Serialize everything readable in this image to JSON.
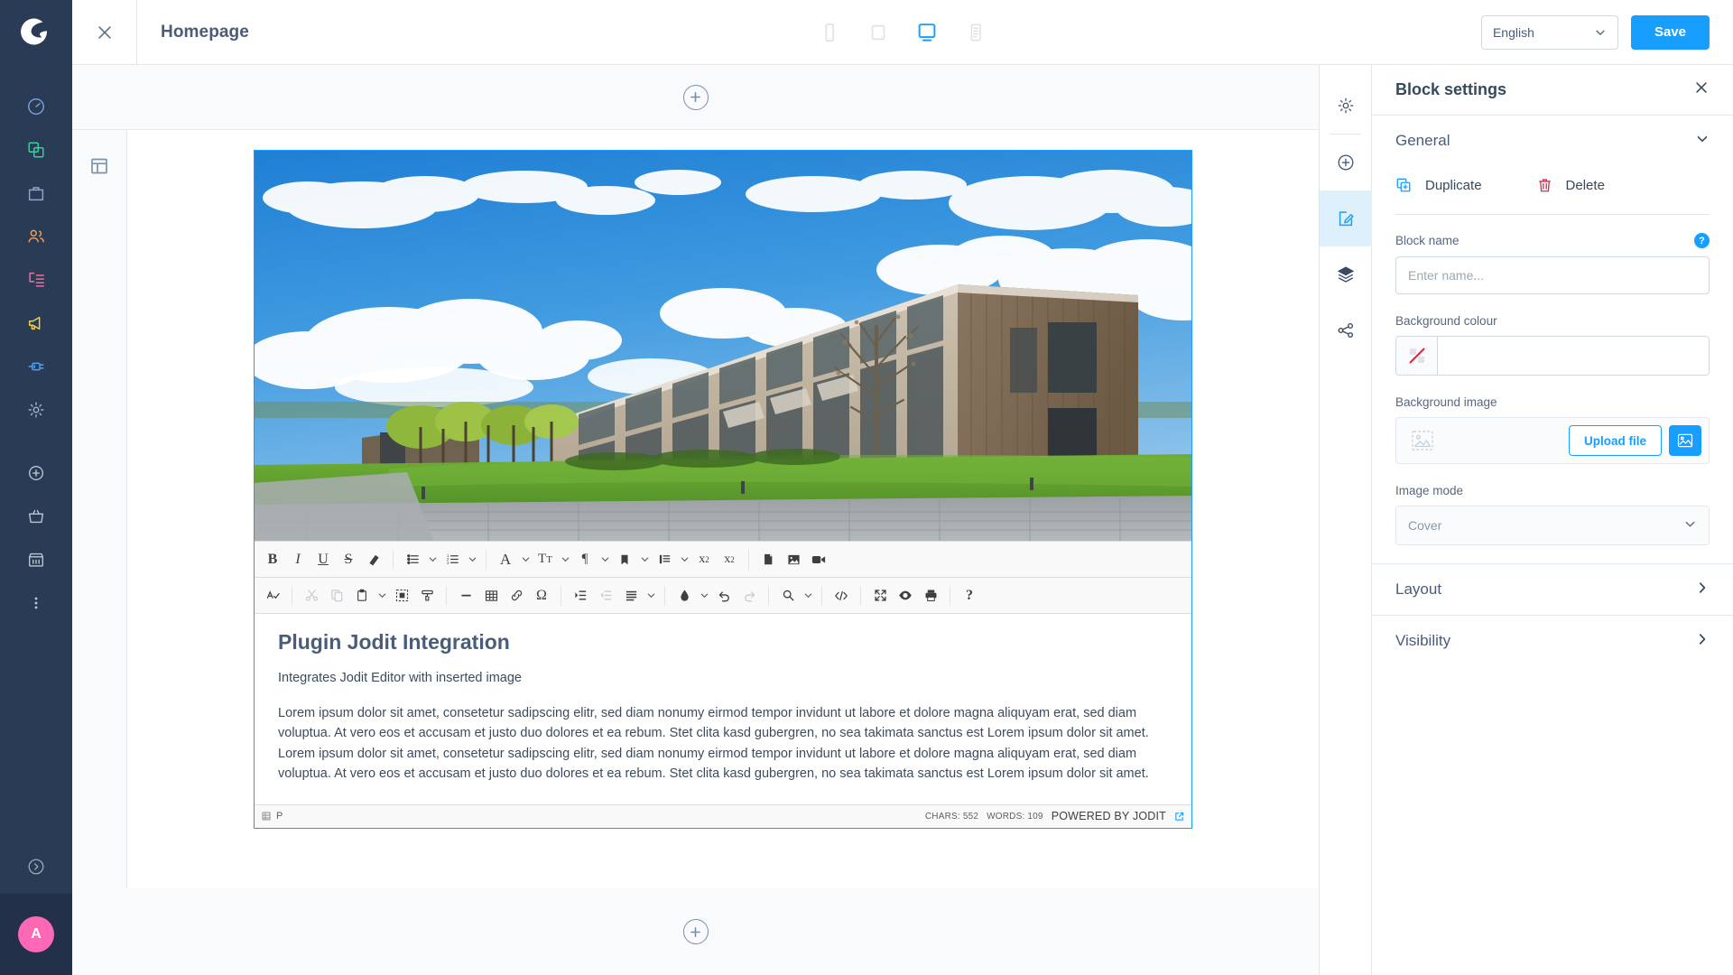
{
  "app": {
    "logo_name": "shopware-logo",
    "avatar_initial": "A",
    "accent_blue": "#189eff",
    "rail_bg": "#2a3b55",
    "avatar_bg": "#ff68b4"
  },
  "nav": {
    "items": [
      {
        "name": "dashboard-icon",
        "label": "Dashboard",
        "color": "#7a9fd4"
      },
      {
        "name": "catalogues-icon",
        "label": "Catalogues",
        "color": "#37d1a0"
      },
      {
        "name": "orders-icon",
        "label": "Orders",
        "color": "#8fa7c4"
      },
      {
        "name": "customers-icon",
        "label": "Customers",
        "color": "#f59b4e"
      },
      {
        "name": "content-icon",
        "label": "Content",
        "color": "#f26da0"
      },
      {
        "name": "marketing-icon",
        "label": "Marketing",
        "color": "#f2d43c"
      },
      {
        "name": "extensions-icon",
        "label": "Extensions",
        "color": "#4da2f5"
      },
      {
        "name": "settings-icon",
        "label": "Settings",
        "color": "#9fb0c6"
      }
    ],
    "secondary": [
      {
        "name": "add-icon",
        "label": "Add"
      },
      {
        "name": "basket-icon",
        "label": "Basket"
      },
      {
        "name": "storefront-icon",
        "label": "Storefront"
      },
      {
        "name": "more-options-icon",
        "label": "More"
      }
    ],
    "expand": {
      "name": "expand-sidebar-icon",
      "label": "Expand"
    }
  },
  "header": {
    "close_label": "Close",
    "title": "Homepage",
    "devices": [
      {
        "name": "device-mobile-icon",
        "label": "Mobile",
        "active": false
      },
      {
        "name": "device-tablet-icon",
        "label": "Tablet",
        "active": false
      },
      {
        "name": "device-desktop-icon",
        "label": "Desktop",
        "active": true
      },
      {
        "name": "device-form-icon",
        "label": "Form",
        "active": false
      }
    ],
    "language": "English",
    "save_label": "Save"
  },
  "stage": {
    "add_block_top_label": "Add block",
    "add_block_bottom_label": "Add block",
    "sidebar_toggle_name": "layout-panel-icon",
    "hero_image_alt": "Modern wooden office building with blue sky and green lawn"
  },
  "editor": {
    "toolbar_row1": [
      {
        "name": "bold-button",
        "glyph": "B",
        "style": "bold-serif",
        "disabled": false
      },
      {
        "name": "italic-button",
        "glyph": "I",
        "style": "italic-serif",
        "disabled": false
      },
      {
        "name": "underline-button",
        "glyph": "U",
        "style": "underline-serif",
        "disabled": false
      },
      {
        "name": "strikethrough-button",
        "glyph": "S",
        "style": "strike-serif",
        "disabled": false
      },
      {
        "name": "eraser-button",
        "glyph": "eraser",
        "style": "svg",
        "disabled": false
      },
      {
        "name": "separator",
        "glyph": "",
        "style": "sep",
        "disabled": false
      },
      {
        "name": "unordered-list-button",
        "glyph": "ul",
        "style": "svg",
        "disabled": false
      },
      {
        "name": "unordered-list-caret",
        "glyph": "caret",
        "style": "caret",
        "disabled": false
      },
      {
        "name": "ordered-list-button",
        "glyph": "ol",
        "style": "svg",
        "disabled": false
      },
      {
        "name": "ordered-list-caret",
        "glyph": "caret",
        "style": "caret",
        "disabled": false
      },
      {
        "name": "separator",
        "glyph": "",
        "style": "sep",
        "disabled": false
      },
      {
        "name": "font-family-button",
        "glyph": "A",
        "style": "serif",
        "disabled": false
      },
      {
        "name": "font-family-caret",
        "glyph": "caret",
        "style": "caret",
        "disabled": false
      },
      {
        "name": "font-size-button",
        "glyph": "TT",
        "style": "serif-sm",
        "disabled": false
      },
      {
        "name": "font-size-caret",
        "glyph": "caret",
        "style": "caret",
        "disabled": false
      },
      {
        "name": "paragraph-button",
        "glyph": "¶",
        "style": "serif",
        "disabled": false
      },
      {
        "name": "paragraph-caret",
        "glyph": "caret",
        "style": "caret",
        "disabled": false
      },
      {
        "name": "classes-button",
        "glyph": "book",
        "style": "svg",
        "disabled": false
      },
      {
        "name": "classes-caret",
        "glyph": "caret",
        "style": "caret",
        "disabled": false
      },
      {
        "name": "line-height-button",
        "glyph": "lineheight",
        "style": "svg",
        "disabled": false
      },
      {
        "name": "line-height-caret",
        "glyph": "caret",
        "style": "caret",
        "disabled": false
      },
      {
        "name": "superscript-button",
        "glyph": "x²",
        "style": "sup",
        "disabled": false
      },
      {
        "name": "subscript-button",
        "glyph": "x₂",
        "style": "sub",
        "disabled": false
      },
      {
        "name": "separator",
        "glyph": "",
        "style": "sep",
        "disabled": false
      },
      {
        "name": "insert-file-button",
        "glyph": "file",
        "style": "svg",
        "disabled": false
      },
      {
        "name": "insert-image-button",
        "glyph": "image",
        "style": "svg",
        "disabled": false
      },
      {
        "name": "insert-video-button",
        "glyph": "video",
        "style": "svg",
        "disabled": false
      }
    ],
    "toolbar_row2": [
      {
        "name": "spellcheck-button",
        "glyph": "spell",
        "style": "svg",
        "disabled": false
      },
      {
        "name": "separator",
        "glyph": "",
        "style": "sep",
        "disabled": false
      },
      {
        "name": "cut-button",
        "glyph": "scissors",
        "style": "svg",
        "disabled": true
      },
      {
        "name": "copy-button",
        "glyph": "copy",
        "style": "svg",
        "disabled": true
      },
      {
        "name": "paste-button",
        "glyph": "paste",
        "style": "svg",
        "disabled": false
      },
      {
        "name": "paste-caret",
        "glyph": "caret",
        "style": "caret",
        "disabled": false
      },
      {
        "name": "select-all-button",
        "glyph": "selectall",
        "style": "svg",
        "disabled": false
      },
      {
        "name": "format-brush-button",
        "glyph": "brush",
        "style": "svg",
        "disabled": false
      },
      {
        "name": "separator",
        "glyph": "",
        "style": "sep",
        "disabled": false
      },
      {
        "name": "horizontal-rule-button",
        "glyph": "hr",
        "style": "svg",
        "disabled": false
      },
      {
        "name": "insert-table-button",
        "glyph": "table",
        "style": "svg",
        "disabled": false
      },
      {
        "name": "insert-link-button",
        "glyph": "link",
        "style": "svg",
        "disabled": false
      },
      {
        "name": "special-character-button",
        "glyph": "Ω",
        "style": "serif",
        "disabled": false
      },
      {
        "name": "separator",
        "glyph": "",
        "style": "sep",
        "disabled": false
      },
      {
        "name": "indent-button",
        "glyph": "indent",
        "style": "svg",
        "disabled": false
      },
      {
        "name": "outdent-button",
        "glyph": "outdent",
        "style": "svg",
        "disabled": true
      },
      {
        "name": "align-button",
        "glyph": "align",
        "style": "svg",
        "disabled": false
      },
      {
        "name": "align-caret",
        "glyph": "caret",
        "style": "caret",
        "disabled": false
      },
      {
        "name": "separator",
        "glyph": "",
        "style": "sep",
        "disabled": false
      },
      {
        "name": "text-color-button",
        "glyph": "droplet",
        "style": "svg",
        "disabled": false
      },
      {
        "name": "text-color-caret",
        "glyph": "caret",
        "style": "caret",
        "disabled": false
      },
      {
        "name": "undo-button",
        "glyph": "undo",
        "style": "svg",
        "disabled": false
      },
      {
        "name": "redo-button",
        "glyph": "redo",
        "style": "svg",
        "disabled": true
      },
      {
        "name": "separator",
        "glyph": "",
        "style": "sep",
        "disabled": false
      },
      {
        "name": "find-button",
        "glyph": "search",
        "style": "svg",
        "disabled": false
      },
      {
        "name": "find-caret",
        "glyph": "caret",
        "style": "caret",
        "disabled": false
      },
      {
        "name": "separator",
        "glyph": "",
        "style": "sep",
        "disabled": false
      },
      {
        "name": "source-code-button",
        "glyph": "source",
        "style": "svg",
        "disabled": false
      },
      {
        "name": "separator",
        "glyph": "",
        "style": "sep",
        "disabled": false
      },
      {
        "name": "fullscreen-button",
        "glyph": "fullscreen",
        "style": "svg",
        "disabled": false
      },
      {
        "name": "preview-button",
        "glyph": "eye",
        "style": "svg",
        "disabled": false
      },
      {
        "name": "print-button",
        "glyph": "printer",
        "style": "svg",
        "disabled": false
      },
      {
        "name": "separator",
        "glyph": "",
        "style": "sep",
        "disabled": false
      },
      {
        "name": "about-button",
        "glyph": "?",
        "style": "bold-serif",
        "disabled": false
      }
    ],
    "content": {
      "heading": "Plugin Jodit Integration",
      "subheading": "Integrates Jodit Editor with inserted image",
      "paragraph": "Lorem ipsum dolor sit amet, consetetur sadipscing elitr, sed diam nonumy eirmod tempor invidunt ut labore et dolore magna aliquyam erat, sed diam voluptua. At vero eos et accusam et justo duo dolores et ea rebum. Stet clita kasd gubergren, no sea takimata sanctus est Lorem ipsum dolor sit amet. Lorem ipsum dolor sit amet, consetetur sadipscing elitr, sed diam nonumy eirmod tempor invidunt ut labore et dolore magna aliquyam erat, sed diam voluptua. At vero eos et accusam et justo duo dolores et ea rebum. Stet clita kasd gubergren, no sea takimata sanctus est Lorem ipsum dolor sit amet."
    },
    "status": {
      "path": "P",
      "chars": "CHARS: 552",
      "words": "WORDS: 109",
      "powered": "POWERED BY JODIT"
    }
  },
  "right_rail": [
    {
      "name": "rail-page-settings-icon",
      "label": "Page settings",
      "active": false
    },
    {
      "name": "rail-add-section-icon",
      "label": "Add section",
      "active": false
    },
    {
      "name": "rail-block-settings-icon",
      "label": "Block settings",
      "active": true
    },
    {
      "name": "rail-layers-icon",
      "label": "Layers",
      "active": false
    },
    {
      "name": "rail-share-icon",
      "label": "Share",
      "active": false
    }
  ],
  "settings": {
    "title": "Block settings",
    "close_label": "Close",
    "sections": {
      "general": {
        "label": "General",
        "expanded": true,
        "duplicate_label": "Duplicate",
        "delete_label": "Delete",
        "block_name": {
          "label": "Block name",
          "value": "",
          "placeholder": "Enter name...",
          "help": "?"
        },
        "background_colour": {
          "label": "Background colour",
          "value": "",
          "swatch": "none"
        },
        "background_image": {
          "label": "Background image",
          "upload_label": "Upload file",
          "media_button_name": "open-media-library-icon"
        },
        "image_mode": {
          "label": "Image mode",
          "value": "Cover"
        }
      },
      "layout": {
        "label": "Layout",
        "expanded": false
      },
      "visibility": {
        "label": "Visibility",
        "expanded": false
      }
    }
  }
}
